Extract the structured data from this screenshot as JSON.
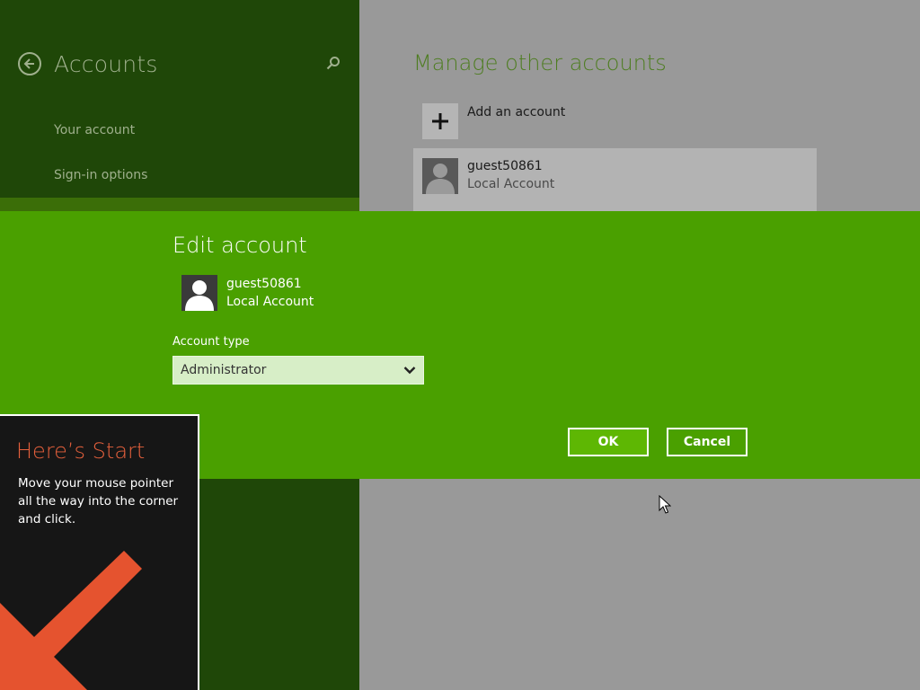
{
  "left": {
    "title": "Accounts",
    "nav": [
      {
        "label": "Your account"
      },
      {
        "label": "Sign-in options"
      }
    ]
  },
  "right": {
    "title": "Manage other accounts",
    "add_account_label": "Add an account",
    "account": {
      "name": "guest50861",
      "type": "Local Account"
    }
  },
  "modal": {
    "title": "Edit account",
    "user": {
      "name": "guest50861",
      "type": "Local Account"
    },
    "account_type_label": "Account type",
    "account_type_value": "Administrator",
    "ok_label": "OK",
    "cancel_label": "Cancel"
  },
  "tip": {
    "title": "Here’s Start",
    "body": "Move your mouse pointer all the way into the corner and click."
  },
  "colors": {
    "modal_bg": "#4aa000",
    "left_pane_bg": "#1f4708",
    "tip_title": "#e5603c",
    "tip_arrow": "#e5532f"
  },
  "icons": {
    "back": "back-arrow-circle-icon",
    "search": "search-icon",
    "add": "plus-icon",
    "avatar": "user-silhouette-icon",
    "dropdown": "chevron-down-icon",
    "tip_arrow": "arrow-down-left-icon",
    "cursor": "mouse-pointer-icon"
  }
}
